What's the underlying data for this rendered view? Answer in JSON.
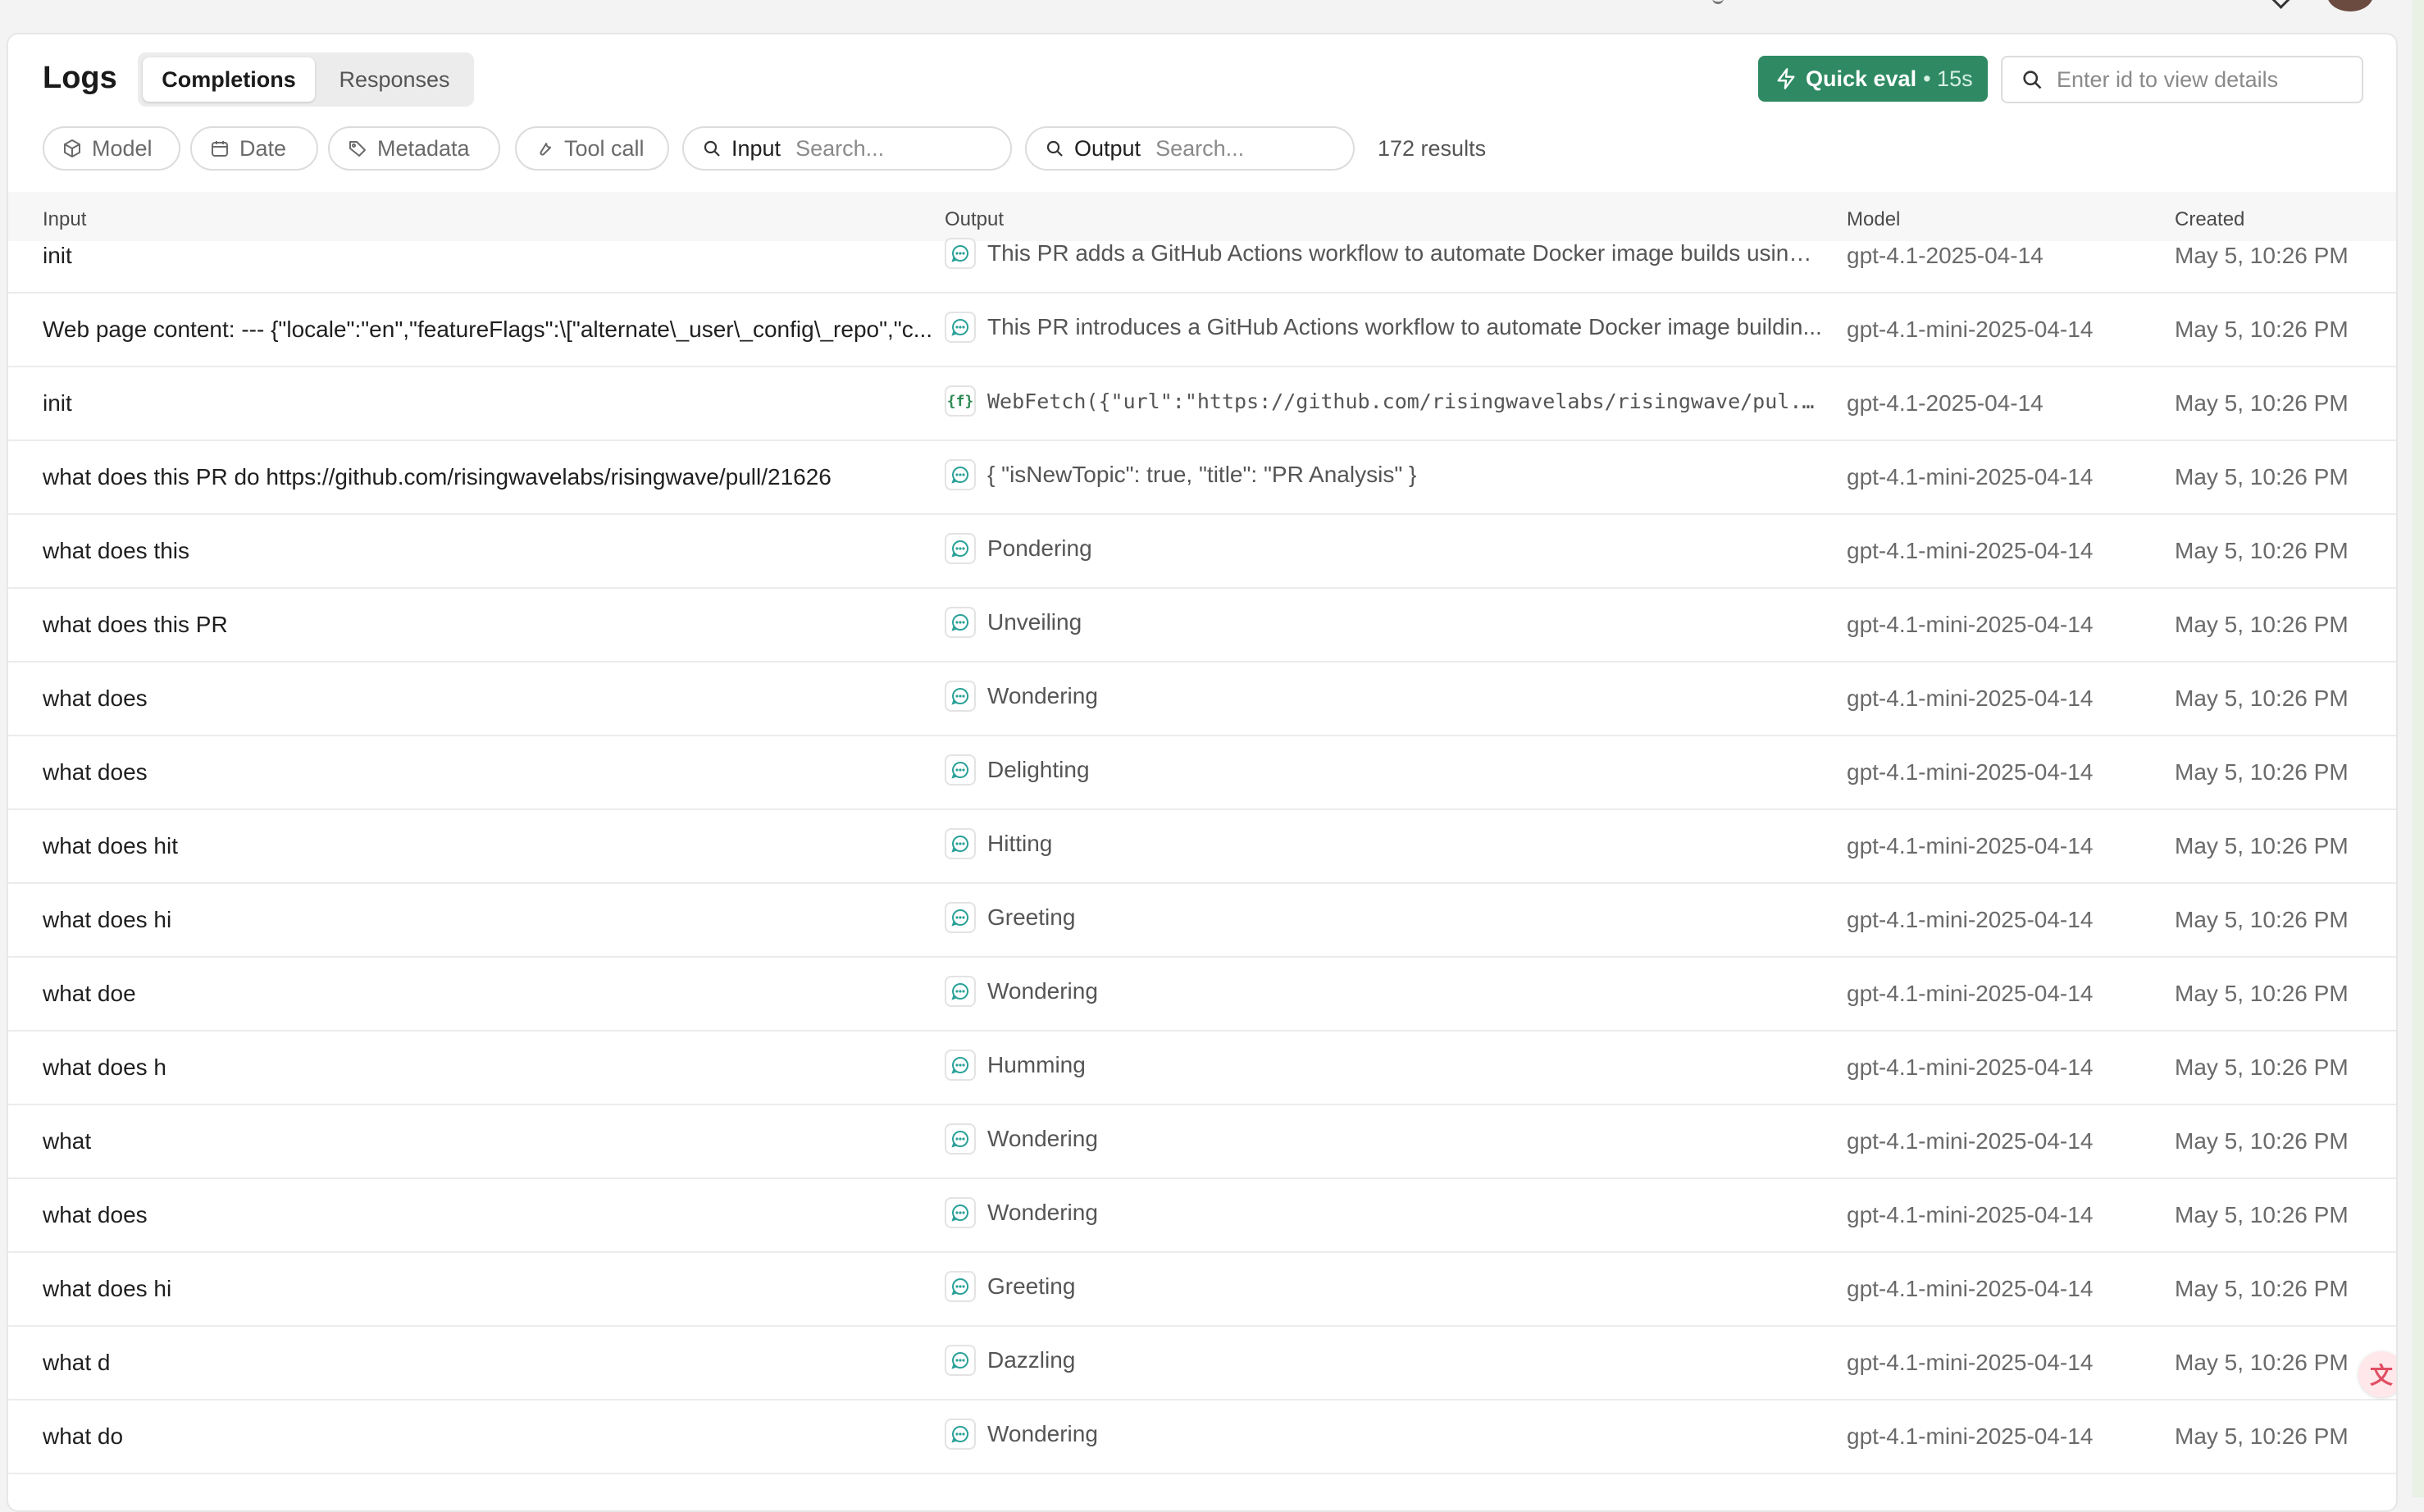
{
  "header": {
    "title": "Logs",
    "tabs": [
      {
        "label": "Completions",
        "active": true
      },
      {
        "label": "Responses",
        "active": false
      }
    ],
    "quick_eval": {
      "label": "Quick eval",
      "suffix": "• 15s"
    },
    "id_search": {
      "placeholder": "Enter id to view details"
    }
  },
  "filters": {
    "model": "Model",
    "date": "Date",
    "metadata": "Metadata",
    "tool_call": "Tool call",
    "input_search": {
      "label": "Input",
      "placeholder": "Search..."
    },
    "output_search": {
      "label": "Output",
      "placeholder": "Search..."
    },
    "results": "172 results"
  },
  "table": {
    "columns": {
      "input": "Input",
      "output": "Output",
      "model": "Model",
      "created": "Created"
    },
    "rows": [
      {
        "input": "init",
        "output": "This PR adds a GitHub Actions workflow to automate Docker image builds using ...",
        "output_icon": "chat-bubble-icon",
        "model": "gpt-4.1-2025-04-14",
        "created": "May 5, 10:26 PM"
      },
      {
        "input": "Web page content: --- {\"locale\":\"en\",\"featureFlags\":\\[\"alternate\\_user\\_config\\_repo\",\"c...",
        "output": "This PR introduces a GitHub Actions workflow to automate Docker image buildin...",
        "output_icon": "chat-bubble-icon",
        "model": "gpt-4.1-mini-2025-04-14",
        "created": "May 5, 10:26 PM"
      },
      {
        "input": "init",
        "output": "WebFetch({\"url\":\"https://github.com/risingwavelabs/risingwave/pul...",
        "output_icon": "function-icon",
        "model": "gpt-4.1-2025-04-14",
        "created": "May 5, 10:26 PM"
      },
      {
        "input": "what does this PR do https://github.com/risingwavelabs/risingwave/pull/21626",
        "output": "{ \"isNewTopic\": true, \"title\": \"PR Analysis\" }",
        "output_icon": "chat-bubble-icon",
        "model": "gpt-4.1-mini-2025-04-14",
        "created": "May 5, 10:26 PM"
      },
      {
        "input": "what does this",
        "output": "Pondering",
        "output_icon": "chat-bubble-icon",
        "model": "gpt-4.1-mini-2025-04-14",
        "created": "May 5, 10:26 PM"
      },
      {
        "input": "what does this PR",
        "output": "Unveiling",
        "output_icon": "chat-bubble-icon",
        "model": "gpt-4.1-mini-2025-04-14",
        "created": "May 5, 10:26 PM"
      },
      {
        "input": "what does",
        "output": "Wondering",
        "output_icon": "chat-bubble-icon",
        "model": "gpt-4.1-mini-2025-04-14",
        "created": "May 5, 10:26 PM"
      },
      {
        "input": "what does",
        "output": "Delighting",
        "output_icon": "chat-bubble-icon",
        "model": "gpt-4.1-mini-2025-04-14",
        "created": "May 5, 10:26 PM"
      },
      {
        "input": "what does hit",
        "output": "Hitting",
        "output_icon": "chat-bubble-icon",
        "model": "gpt-4.1-mini-2025-04-14",
        "created": "May 5, 10:26 PM"
      },
      {
        "input": "what does hi",
        "output": "Greeting",
        "output_icon": "chat-bubble-icon",
        "model": "gpt-4.1-mini-2025-04-14",
        "created": "May 5, 10:26 PM"
      },
      {
        "input": "what doe",
        "output": "Wondering",
        "output_icon": "chat-bubble-icon",
        "model": "gpt-4.1-mini-2025-04-14",
        "created": "May 5, 10:26 PM"
      },
      {
        "input": "what does h",
        "output": "Humming",
        "output_icon": "chat-bubble-icon",
        "model": "gpt-4.1-mini-2025-04-14",
        "created": "May 5, 10:26 PM"
      },
      {
        "input": "what",
        "output": "Wondering",
        "output_icon": "chat-bubble-icon",
        "model": "gpt-4.1-mini-2025-04-14",
        "created": "May 5, 10:26 PM"
      },
      {
        "input": "what does",
        "output": "Wondering",
        "output_icon": "chat-bubble-icon",
        "model": "gpt-4.1-mini-2025-04-14",
        "created": "May 5, 10:26 PM"
      },
      {
        "input": "what does hi",
        "output": "Greeting",
        "output_icon": "chat-bubble-icon",
        "model": "gpt-4.1-mini-2025-04-14",
        "created": "May 5, 10:26 PM"
      },
      {
        "input": "what d",
        "output": "Dazzling",
        "output_icon": "chat-bubble-icon",
        "model": "gpt-4.1-mini-2025-04-14",
        "created": "May 5, 10:26 PM"
      },
      {
        "input": "what do",
        "output": "Wondering",
        "output_icon": "chat-bubble-icon",
        "model": "gpt-4.1-mini-2025-04-14",
        "created": "May 5, 10:26 PM"
      }
    ]
  },
  "colors": {
    "accent": "#2f8a63",
    "chat_icon": "#2aa198",
    "function_icon": "#2d8a53"
  }
}
